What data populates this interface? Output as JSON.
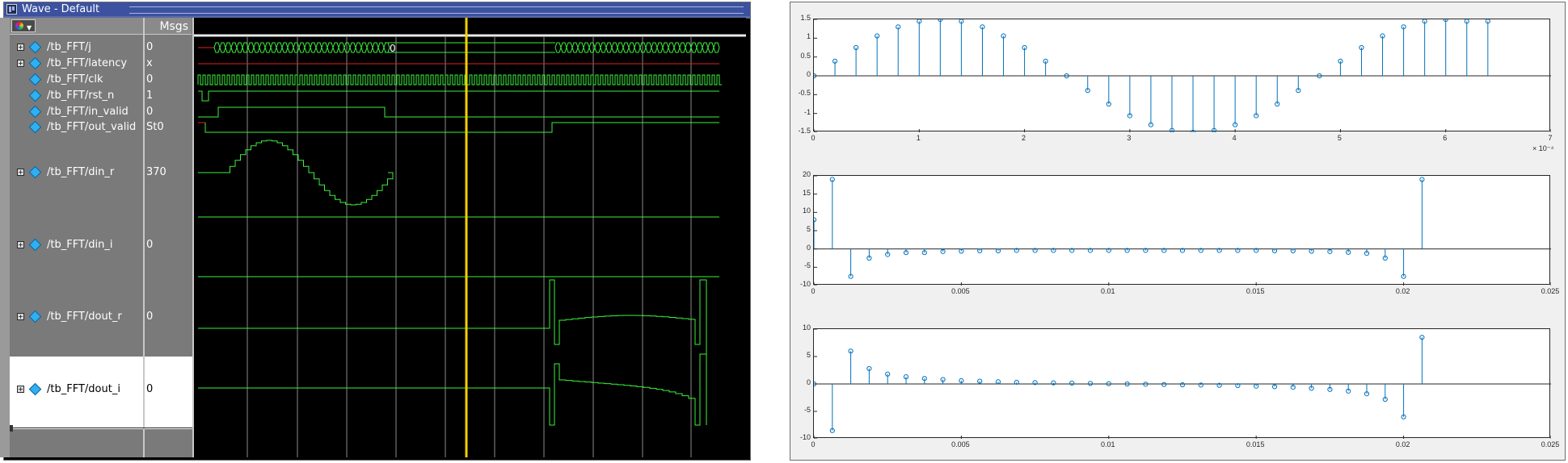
{
  "wave_window": {
    "title": "Wave - Default",
    "column_header_value": "Msgs",
    "signals": [
      {
        "name": "/tb_FFT/j",
        "value": "0",
        "expandable": true
      },
      {
        "name": "/tb_FFT/latency",
        "value": "x",
        "expandable": true
      },
      {
        "name": "/tb_FFT/clk",
        "value": "0",
        "expandable": false
      },
      {
        "name": "/tb_FFT/rst_n",
        "value": "1",
        "expandable": false
      },
      {
        "name": "/tb_FFT/in_valid",
        "value": "0",
        "expandable": false
      },
      {
        "name": "/tb_FFT/out_valid",
        "value": "St0",
        "expandable": false
      },
      {
        "name": "/tb_FFT/din_r",
        "value": "370",
        "expandable": true
      },
      {
        "name": "/tb_FFT/din_i",
        "value": "0",
        "expandable": true
      },
      {
        "name": "/tb_FFT/dout_r",
        "value": "0",
        "expandable": true
      },
      {
        "name": "/tb_FFT/dout_i",
        "value": "0",
        "expandable": true
      }
    ],
    "bus_label_j": "0",
    "cursor_color": "#f5d000",
    "wave_color": "#3cf03c",
    "unknown_color": "#e02020"
  },
  "plot_window": {
    "subplot1": {
      "type": "stem",
      "x_scale_label": "× 10⁻⁴",
      "xticks": [
        "0",
        "1",
        "2",
        "3",
        "4",
        "5",
        "6",
        "7"
      ],
      "yticks": [
        "1.5",
        "1",
        "0.5",
        "0",
        "-0.5",
        "-1",
        "-1.5"
      ],
      "xlim": [
        0,
        7
      ],
      "ylim": [
        -1.5,
        1.5
      ]
    },
    "subplot2": {
      "type": "stem",
      "xticks": [
        "0",
        "0.005",
        "0.01",
        "0.015",
        "0.02",
        "0.025"
      ],
      "yticks": [
        "20",
        "15",
        "10",
        "5",
        "0",
        "-5",
        "-10"
      ],
      "xlim": [
        0,
        0.025
      ],
      "ylim": [
        -10,
        20
      ]
    },
    "subplot3": {
      "type": "stem",
      "xticks": [
        "0",
        "0.005",
        "0.01",
        "0.015",
        "0.02",
        "0.025"
      ],
      "yticks": [
        "10",
        "5",
        "0",
        "-5",
        "-10"
      ],
      "xlim": [
        0,
        0.025
      ],
      "ylim": [
        -10,
        10
      ]
    }
  },
  "chart_data": [
    {
      "type": "scatter",
      "x_scale": "1e-4",
      "x": [
        0,
        0.2,
        0.4,
        0.6,
        0.8,
        1.0,
        1.2,
        1.4,
        1.6,
        1.8,
        2.0,
        2.2,
        2.4,
        2.6,
        2.8,
        3.0,
        3.2,
        3.4,
        3.6,
        3.8,
        4.0,
        4.2,
        4.4,
        4.6,
        4.8,
        5.0,
        5.2,
        5.4,
        5.6,
        5.8,
        6.0,
        6.2,
        6.4
      ],
      "values": [
        0,
        0.39,
        0.75,
        1.06,
        1.3,
        1.45,
        1.5,
        1.45,
        1.3,
        1.06,
        0.75,
        0.39,
        0,
        -0.39,
        -0.75,
        -1.06,
        -1.3,
        -1.45,
        -1.5,
        -1.45,
        -1.3,
        -1.06,
        -0.75,
        -0.39,
        0,
        0.39,
        0.75,
        1.06,
        1.3,
        1.45,
        1.5,
        1.45,
        1.45
      ],
      "xlim": [
        0,
        7
      ],
      "ylim": [
        -1.5,
        1.5
      ]
    },
    {
      "type": "scatter",
      "x": [
        0,
        0.000625,
        0.00125,
        0.001875,
        0.0025,
        0.003125,
        0.00375,
        0.004375,
        0.005,
        0.005625,
        0.00625,
        0.006875,
        0.0075,
        0.008125,
        0.00875,
        0.009375,
        0.01,
        0.010625,
        0.01125,
        0.011875,
        0.0125,
        0.013125,
        0.01375,
        0.014375,
        0.015,
        0.015625,
        0.01625,
        0.016875,
        0.0175,
        0.018125,
        0.01875,
        0.019375,
        0.02,
        0.020625
      ],
      "values": [
        8,
        19,
        -7.5,
        -2.5,
        -1.5,
        -1,
        -1,
        -0.7,
        -0.6,
        -0.5,
        -0.5,
        -0.4,
        -0.4,
        -0.4,
        -0.4,
        -0.4,
        -0.4,
        -0.4,
        -0.4,
        -0.4,
        -0.4,
        -0.4,
        -0.4,
        -0.4,
        -0.4,
        -0.5,
        -0.5,
        -0.6,
        -0.7,
        -0.9,
        -1.2,
        -2.5,
        -7.5,
        19
      ],
      "xlim": [
        0,
        0.025
      ],
      "ylim": [
        -10,
        20
      ]
    },
    {
      "type": "scatter",
      "x": [
        0,
        0.000625,
        0.00125,
        0.001875,
        0.0025,
        0.003125,
        0.00375,
        0.004375,
        0.005,
        0.005625,
        0.00625,
        0.006875,
        0.0075,
        0.008125,
        0.00875,
        0.009375,
        0.01,
        0.010625,
        0.01125,
        0.011875,
        0.0125,
        0.013125,
        0.01375,
        0.014375,
        0.015,
        0.015625,
        0.01625,
        0.016875,
        0.0175,
        0.018125,
        0.01875,
        0.019375,
        0.02,
        0.020625
      ],
      "values": [
        0,
        -8.5,
        6,
        2.8,
        1.8,
        1.3,
        1,
        0.8,
        0.6,
        0.5,
        0.4,
        0.3,
        0.25,
        0.2,
        0.15,
        0.1,
        0.05,
        0,
        -0.05,
        -0.1,
        -0.15,
        -0.2,
        -0.25,
        -0.3,
        -0.4,
        -0.5,
        -0.6,
        -0.8,
        -1,
        -1.3,
        -1.8,
        -2.8,
        -6,
        8.5
      ],
      "xlim": [
        0,
        0.025
      ],
      "ylim": [
        -10,
        10
      ]
    }
  ]
}
